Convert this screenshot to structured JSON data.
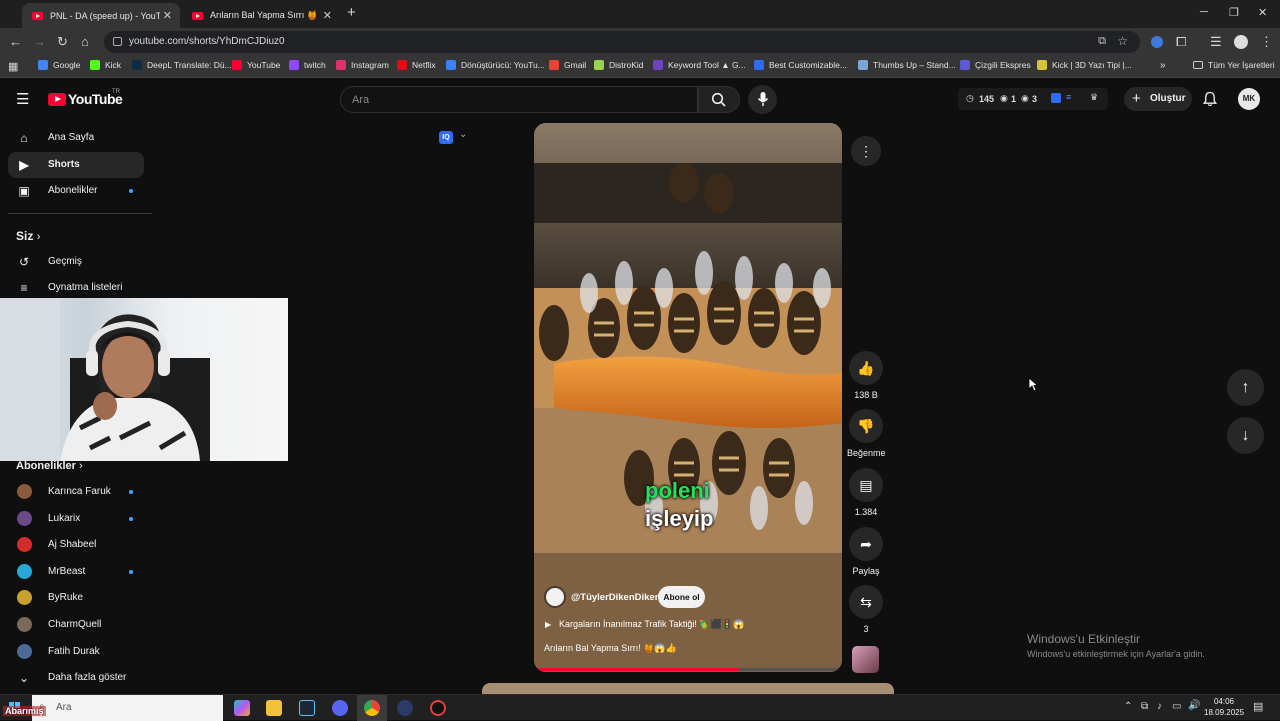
{
  "browser": {
    "tabs": [
      {
        "title": "PNL - DA (speed up) - YouTube"
      },
      {
        "title": "Arıların Bal Yapma Sırrı 🍯 (🔊"
      }
    ],
    "url": "youtube.com/shorts/YhDmCJDiuz0",
    "bookmarks": [
      {
        "label": "Google",
        "color": "#4285f4"
      },
      {
        "label": "Kick",
        "color": "#53fc18"
      },
      {
        "label": "DeepL Translate: Dü...",
        "color": "#0f2b46"
      },
      {
        "label": "YouTube",
        "color": "#ff0033"
      },
      {
        "label": "twitch",
        "color": "#9146ff"
      },
      {
        "label": "Instagram",
        "color": "#e1306c"
      },
      {
        "label": "Netflix",
        "color": "#e50914"
      },
      {
        "label": "Dönüştürücü: YouTu...",
        "color": "#3a82f7"
      },
      {
        "label": "Gmail",
        "color": "#ea4335"
      },
      {
        "label": "DistroKid",
        "color": "#9ad34d"
      },
      {
        "label": "Keyword Tool ▲ G...",
        "color": "#6f42c1"
      },
      {
        "label": "Best Customizable...",
        "color": "#2f6cf5"
      },
      {
        "label": "Thumbs Up – Stand...",
        "color": "#7aa6d8"
      },
      {
        "label": "Çizgili Ekspres",
        "color": "#5b5bd6"
      },
      {
        "label": "Kick | 3D Yazı Tipi |...",
        "color": "#d8c23a"
      }
    ],
    "all_bookmarks_label": "Tüm Yer İşaretleri"
  },
  "header": {
    "logo_text": "YouTube",
    "logo_country": "TR",
    "search_placeholder": "Ara",
    "ext_views": "145",
    "ext_count1": "1",
    "ext_count2": "3",
    "create_label": "Oluştur",
    "avatar_initials": "MK"
  },
  "sidebar": {
    "main": [
      {
        "label": "Ana Sayfa",
        "icon": "home-icon"
      },
      {
        "label": "Shorts",
        "icon": "shorts-icon"
      },
      {
        "label": "Abonelikler",
        "icon": "subscriptions-icon"
      }
    ],
    "you_heading": "Siz",
    "you_items": [
      {
        "label": "Geçmiş",
        "icon": "history-icon"
      },
      {
        "label": "Oynatma listeleri",
        "icon": "playlist-icon"
      }
    ],
    "subs_heading": "Abonelikler",
    "channels": [
      {
        "name": "Karınca Faruk",
        "new": true,
        "color": "#8a5a3c"
      },
      {
        "name": "Lukarix",
        "new": true,
        "color": "#6b4a8a"
      },
      {
        "name": "Aj Shabeel",
        "new": false,
        "color": "#d62b2b"
      },
      {
        "name": "MrBeast",
        "new": true,
        "color": "#2aa7d9"
      },
      {
        "name": "ByRuke",
        "new": false,
        "color": "#caa12e"
      },
      {
        "name": "CharmQuell",
        "new": false,
        "color": "#7a6a5a"
      },
      {
        "name": "Fatih Durak",
        "new": false,
        "color": "#4a6a9a"
      }
    ],
    "show_more_label": "Daha fazla göster"
  },
  "short": {
    "overlay_caption_green": "poleni",
    "overlay_caption_white": "işleyip",
    "channel": "@TüylerDikenDiken",
    "subscribe_label": "Abone ol",
    "suggestion": "Kargaların İnanılmaz Trafik Taktiği! 🦜⬛🚦😱",
    "title": "Arıların Bal Yapma Sırrı! 🍯😱👍",
    "progress_fraction": 0.67,
    "likes": "138 B",
    "dislike_label": "Beğenme",
    "comments": "1.384",
    "share_label": "Paylaş",
    "remix_count": "3"
  },
  "windows": {
    "activate_title": "Windows'u Etkinleştir",
    "activate_sub": "Windows'u etkinleştirmek için Ayarlar'a gidin.",
    "search_label": "Ara",
    "time": "04:06",
    "date": "18.09.2025",
    "overlay_name": "Abarımış"
  }
}
